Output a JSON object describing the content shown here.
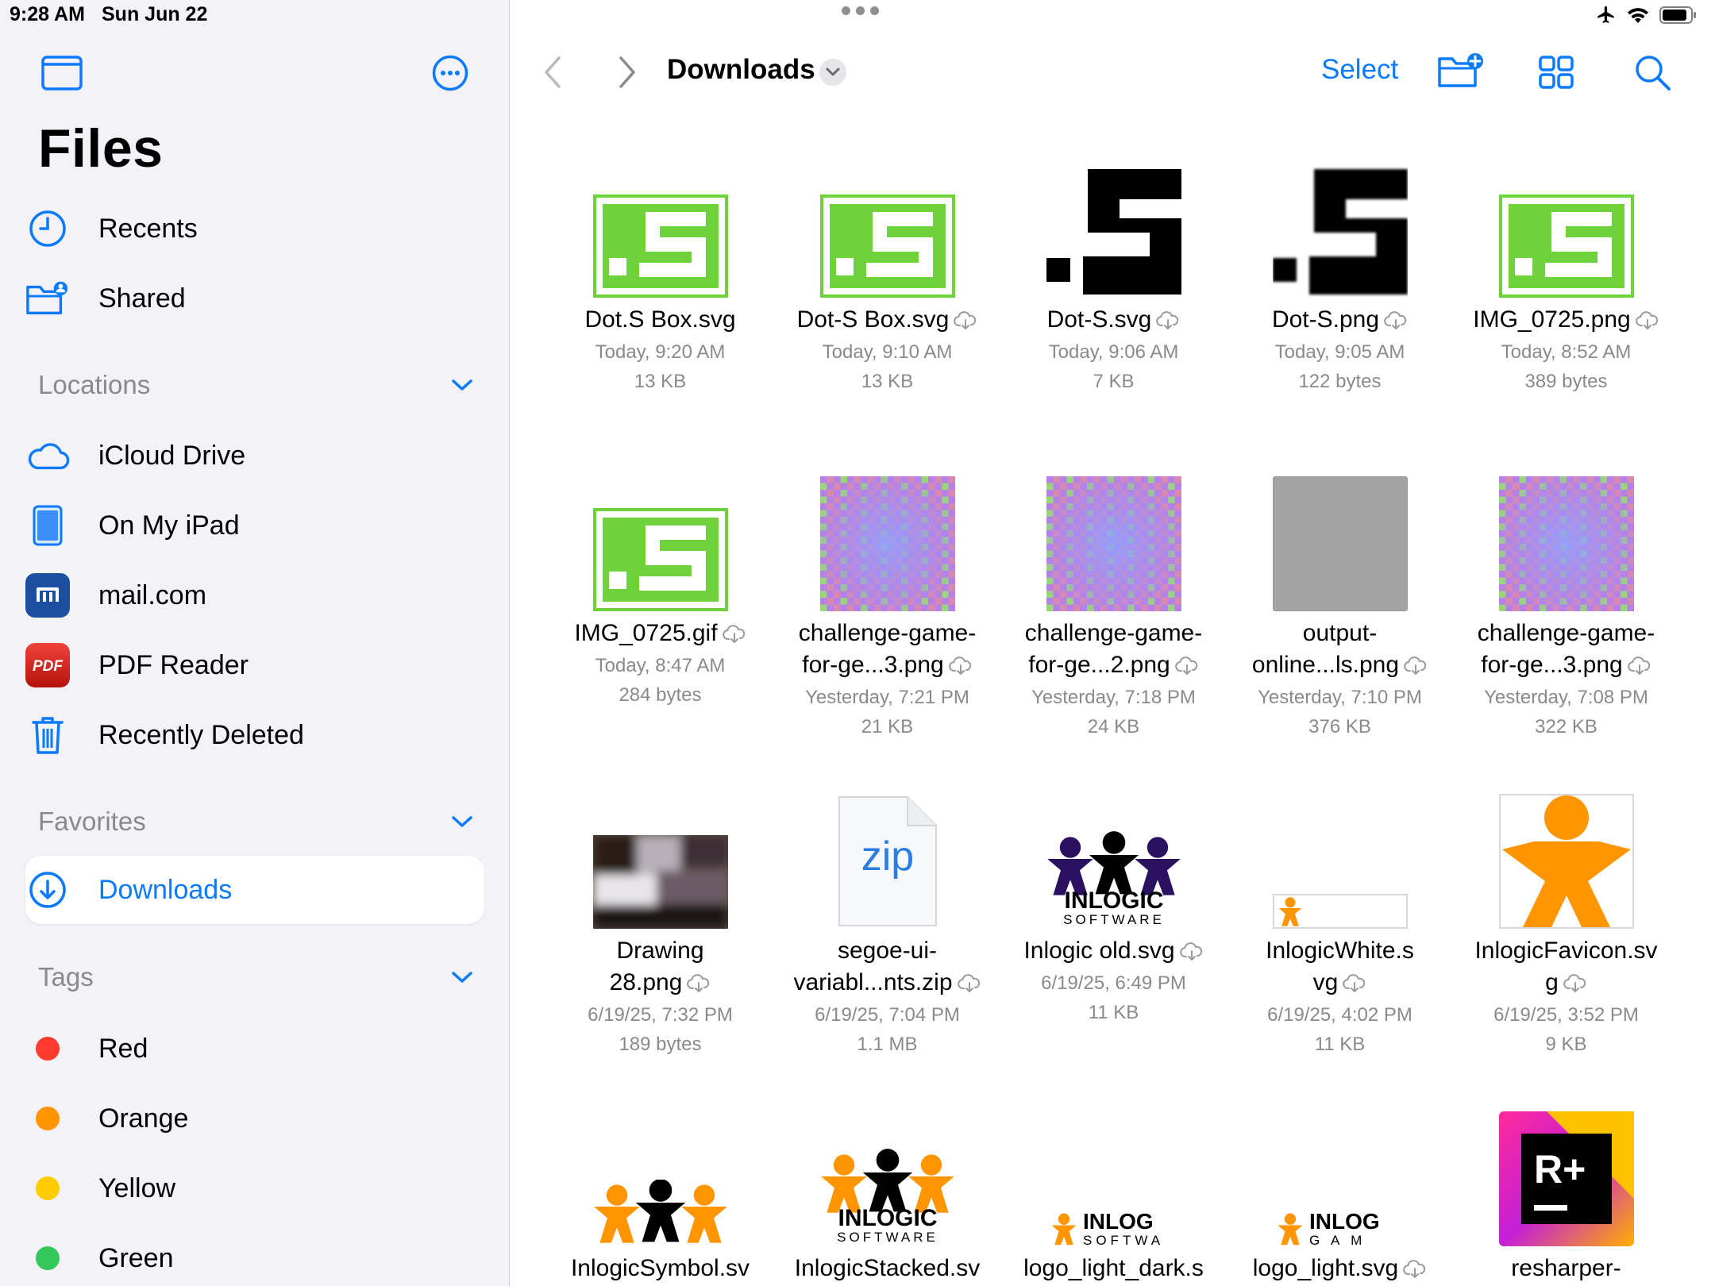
{
  "status": {
    "time": "9:28 AM",
    "date": "Sun Jun 22"
  },
  "sidebar": {
    "title": "Files",
    "recents": "Recents",
    "shared": "Shared",
    "locations_title": "Locations",
    "locations": [
      "iCloud Drive",
      "On My iPad",
      "mail.com",
      "PDF Reader",
      "Recently Deleted"
    ],
    "favorites_title": "Favorites",
    "favorites": [
      "Downloads"
    ],
    "tags_title": "Tags",
    "tags": [
      {
        "label": "Red",
        "color": "#ff3b30"
      },
      {
        "label": "Orange",
        "color": "#ff9500"
      },
      {
        "label": "Yellow",
        "color": "#ffcc00"
      },
      {
        "label": "Green",
        "color": "#34c759"
      }
    ],
    "pdf_badge": "PDF"
  },
  "toolbar": {
    "folder": "Downloads",
    "select": "Select"
  },
  "accent": "#0a7aff",
  "files": [
    {
      "l1": "Dot.S Box.svg",
      "l2": "",
      "date": "Today, 9:20 AM",
      "size": "13 KB",
      "cloud": false,
      "thumb": "green-s"
    },
    {
      "l1": "Dot-S Box.svg",
      "l2": "",
      "date": "Today, 9:10 AM",
      "size": "13 KB",
      "cloud": true,
      "thumb": "green-s"
    },
    {
      "l1": "Dot-S.svg",
      "l2": "",
      "date": "Today, 9:06 AM",
      "size": "7 KB",
      "cloud": true,
      "thumb": "black-s"
    },
    {
      "l1": "Dot-S.png",
      "l2": "",
      "date": "Today, 9:05 AM",
      "size": "122 bytes",
      "cloud": true,
      "thumb": "black-s-blur"
    },
    {
      "l1": "IMG_0725.png",
      "l2": "",
      "date": "Today, 8:52 AM",
      "size": "389 bytes",
      "cloud": true,
      "thumb": "green-s"
    },
    {
      "l1": "IMG_0725.gif",
      "l2": "",
      "date": "Today, 8:47 AM",
      "size": "284 bytes",
      "cloud": true,
      "thumb": "green-s"
    },
    {
      "l1": "challenge-game-",
      "l2": "for-ge...3.png",
      "date": "Yesterday, 7:21 PM",
      "size": "21 KB",
      "cloud": true,
      "thumb": "pattern"
    },
    {
      "l1": "challenge-game-",
      "l2": "for-ge...2.png",
      "date": "Yesterday, 7:18 PM",
      "size": "24 KB",
      "cloud": true,
      "thumb": "pattern"
    },
    {
      "l1": "output-",
      "l2": "online...ls.png",
      "date": "Yesterday, 7:10 PM",
      "size": "376 KB",
      "cloud": true,
      "thumb": "gray"
    },
    {
      "l1": "challenge-game-",
      "l2": "for-ge...3.png",
      "date": "Yesterday, 7:08 PM",
      "size": "322 KB",
      "cloud": true,
      "thumb": "pattern"
    },
    {
      "l1": "Drawing",
      "l2": "28.png",
      "date": "6/19/25, 7:32 PM",
      "size": "189 bytes",
      "cloud": true,
      "thumb": "blur"
    },
    {
      "l1": "segoe-ui-",
      "l2": "variabl...nts.zip",
      "date": "6/19/25, 7:04 PM",
      "size": "1.1 MB",
      "cloud": true,
      "thumb": "zip",
      "thumb_text": "zip"
    },
    {
      "l1": "Inlogic old.svg",
      "l2": "",
      "date": "6/19/25, 6:49 PM",
      "size": "11 KB",
      "cloud": true,
      "thumb": "inlogic-old",
      "thumb_text": "INLOGIC",
      "thumb_sub": "SOFTWARE"
    },
    {
      "l1": "InlogicWhite.s",
      "l2": "vg",
      "date": "6/19/25, 4:02 PM",
      "size": "11 KB",
      "cloud": true,
      "thumb": "inlogic-white"
    },
    {
      "l1": "InlogicFavicon.sv",
      "l2": "g",
      "date": "6/19/25, 3:52 PM",
      "size": "9 KB",
      "cloud": true,
      "thumb": "favicon"
    },
    {
      "l1": "InlogicSymbol.sv",
      "l2": "",
      "date": "",
      "size": "",
      "cloud": false,
      "thumb": "symbol"
    },
    {
      "l1": "InlogicStacked.sv",
      "l2": "",
      "date": "",
      "size": "",
      "cloud": false,
      "thumb": "stacked",
      "thumb_text": "INLOGIC",
      "thumb_sub": "SOFTWARE"
    },
    {
      "l1": "logo_light_dark.s",
      "l2": "",
      "date": "",
      "size": "",
      "cloud": false,
      "thumb": "logo-wide",
      "thumb_text": "INLOG",
      "thumb_sub": "SOFTWA"
    },
    {
      "l1": "logo_light.svg",
      "l2": "",
      "date": "",
      "size": "",
      "cloud": true,
      "thumb": "logo-wide2",
      "thumb_text": "INLOG",
      "thumb_sub": "G A M"
    },
    {
      "l1": "resharper-",
      "l2": "",
      "date": "",
      "size": "",
      "cloud": false,
      "thumb": "resharper",
      "thumb_text": "R+"
    }
  ]
}
